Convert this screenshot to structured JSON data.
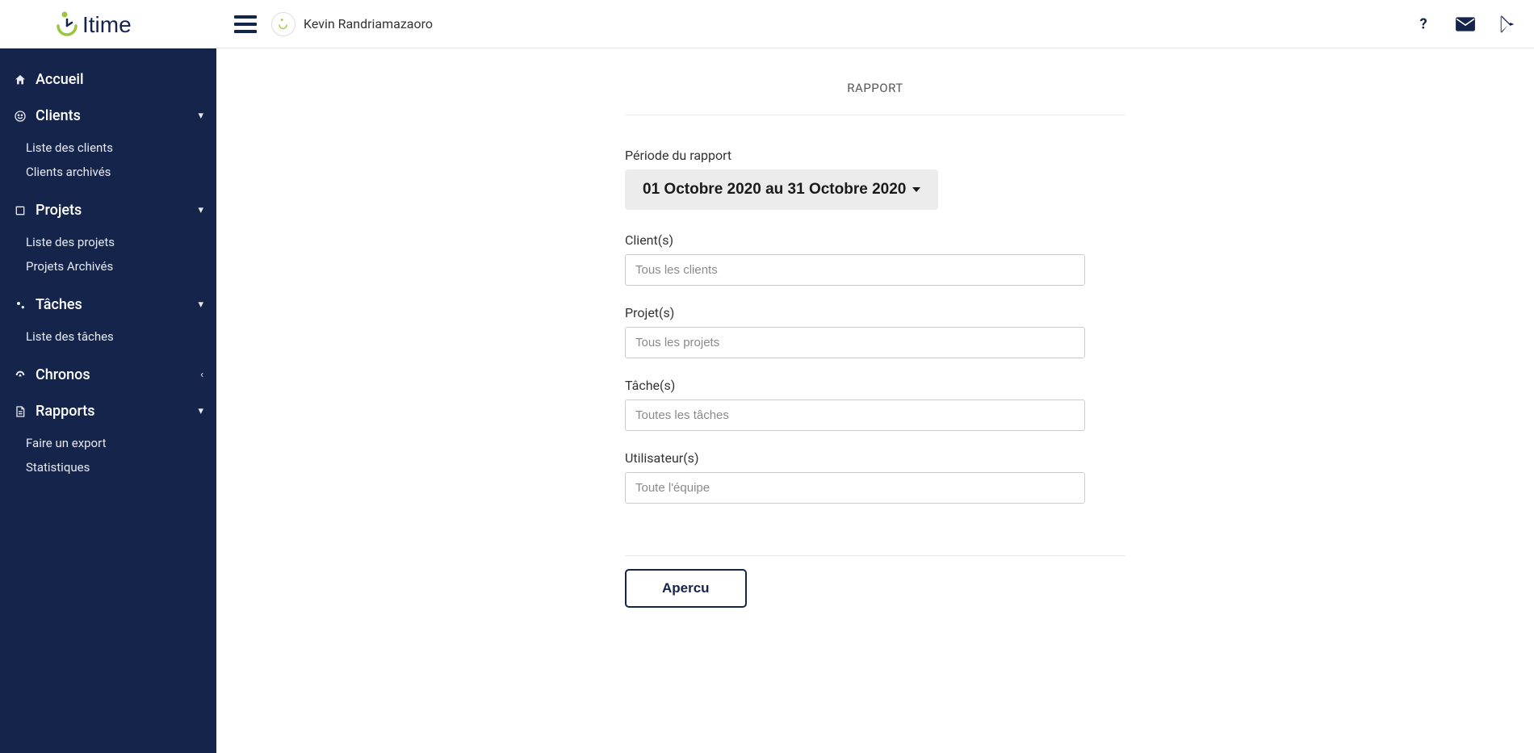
{
  "brand": {
    "name": "Itime"
  },
  "topbar": {
    "username": "Kevin Randriamazaoro"
  },
  "sidebar": {
    "home": "Accueil",
    "clients": {
      "label": "Clients",
      "items": [
        "Liste des clients",
        "Clients archivés"
      ]
    },
    "projects": {
      "label": "Projets",
      "items": [
        "Liste des projets",
        "Projets Archivés"
      ]
    },
    "tasks": {
      "label": "Tâches",
      "items": [
        "Liste des tâches"
      ]
    },
    "chronos": {
      "label": "Chronos"
    },
    "reports": {
      "label": "Rapports",
      "items": [
        "Faire un export",
        "Statistiques"
      ]
    }
  },
  "report": {
    "title": "RAPPORT",
    "period_label": "Période du rapport",
    "period_value": "01 Octobre 2020 au 31 Octobre 2020",
    "client_label": "Client(s)",
    "client_placeholder": "Tous les clients",
    "project_label": "Projet(s)",
    "project_placeholder": "Tous les projets",
    "task_label": "Tâche(s)",
    "task_placeholder": "Toutes les tâches",
    "user_label": "Utilisateur(s)",
    "user_placeholder": "Toute l'équipe",
    "preview_button": "Apercu"
  }
}
